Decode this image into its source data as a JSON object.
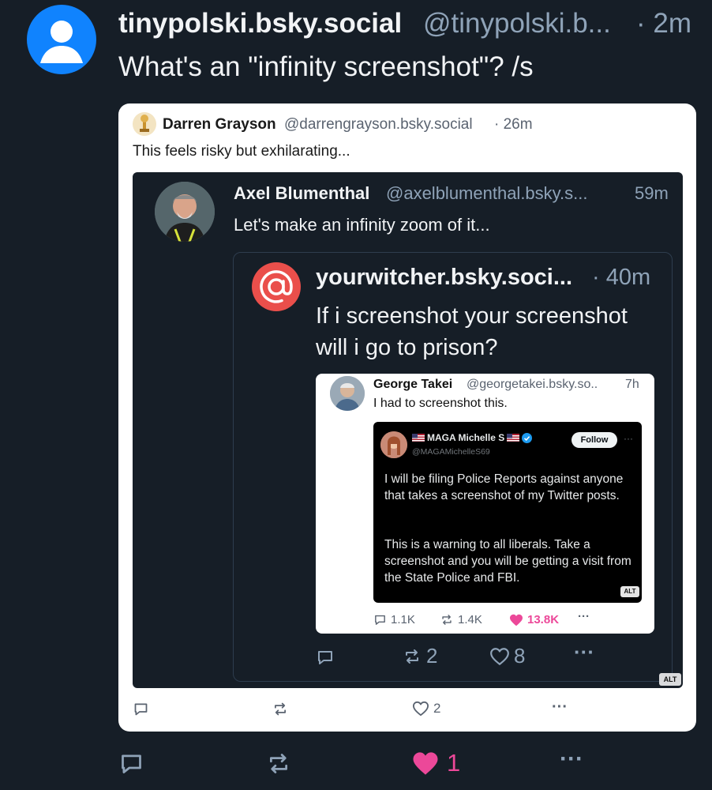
{
  "post": {
    "name": "tinypolski.bsky.social",
    "handle": "@tinypolski.b...",
    "time": "· 2m",
    "text": "What's an \"infinity screenshot\"? /s",
    "likes": "1"
  },
  "quote1": {
    "name": "Darren Grayson",
    "handle": "@darrengrayson.bsky.social",
    "time": "· 26m",
    "text": "This feels risky but exhilarating...",
    "likes": "2"
  },
  "quote2": {
    "name": "Axel Blumenthal",
    "handle": "@axelblumenthal.bsky.s...",
    "time": "59m",
    "text": "Let's make an infinity zoom of it...",
    "alt": "ALT"
  },
  "quote3": {
    "name": "yourwitcher.bsky.soci...",
    "time": "· 40m",
    "text": "If i screenshot your screenshot will i go to prison?",
    "reposts": "2",
    "likes": "8"
  },
  "quote4": {
    "name": "George Takei",
    "handle": "@georgetakei.bsky.so..",
    "time": "7h",
    "text": "I had to screenshot this.",
    "replies": "1.1K",
    "reposts": "1.4K",
    "likes": "13.8K"
  },
  "tweet": {
    "name": "MAGA Michelle S",
    "handle": "@MAGAMichelleS69",
    "follow": "Follow",
    "more": "···",
    "p1": "I will be filing Police Reports against anyone that takes a screenshot of my Twitter posts.",
    "p2": "This is a warning to all liberals. Take a screenshot and you will be getting a visit from the State Police and FBI.",
    "alt": "ALT"
  },
  "colors": {
    "background": "#161e27",
    "avatar_blue": "#1083fe",
    "like_pink": "#ec4899",
    "at_red": "#ea4f4b"
  },
  "icons": [
    "person-icon",
    "at-sign-icon",
    "reply-icon",
    "repost-icon",
    "heart-icon",
    "more-icon",
    "verified-icon",
    "flag-icon"
  ]
}
